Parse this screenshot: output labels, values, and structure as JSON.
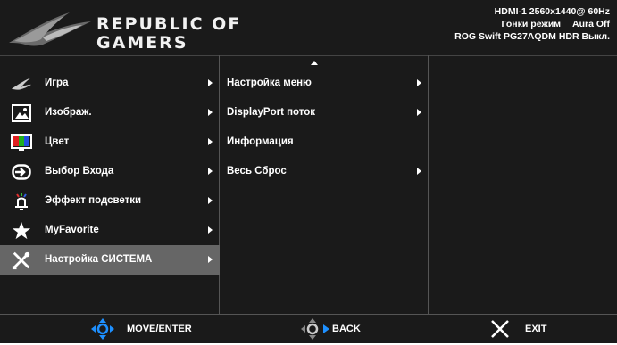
{
  "header": {
    "brand_line1": "REPUBLIC OF",
    "brand_line2": "GAMERS",
    "status": {
      "input": "HDMI-1",
      "resolution": "2560x1440@",
      "refresh": "60Hz",
      "mode": "Гонки режим",
      "aura": "Aura Off",
      "series": "ROG Swift",
      "model": "PG27AQDM",
      "hdr": "HDR Выкл."
    }
  },
  "main_menu": [
    {
      "label": "Игра",
      "icon": "rog-eye-icon"
    },
    {
      "label": "Изображ.",
      "icon": "image-icon"
    },
    {
      "label": "Цвет",
      "icon": "color-icon"
    },
    {
      "label": "Выбор Входа",
      "icon": "input-icon"
    },
    {
      "label": "Эффект подсветки",
      "icon": "lighting-icon"
    },
    {
      "label": "MyFavorite",
      "icon": "star-icon"
    },
    {
      "label": "Настройка СИСТЕМА",
      "icon": "wrench-icon",
      "selected": true
    }
  ],
  "submenu": [
    {
      "label": "Настройка меню",
      "has_arrow": true
    },
    {
      "label": "DisplayPort поток",
      "has_arrow": true
    },
    {
      "label": "Информация",
      "has_arrow": false
    },
    {
      "label": "Весь Сброс",
      "has_arrow": true
    }
  ],
  "footer": {
    "move_label": "MOVE/ENTER",
    "back_label": "BACK",
    "exit_label": "EXIT"
  },
  "colors": {
    "background": "#1a1a1a",
    "selected": "#666666",
    "joystick": "#1e90ff",
    "text": "#ffffff"
  }
}
